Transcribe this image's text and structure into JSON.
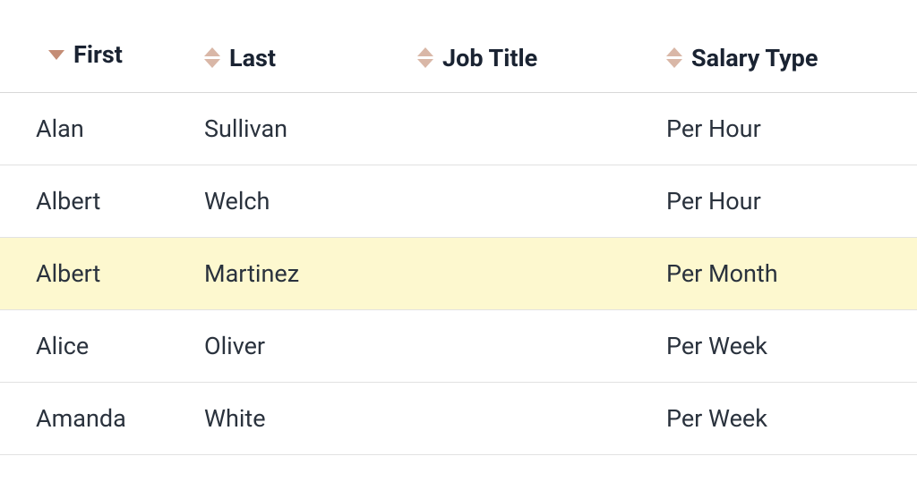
{
  "table": {
    "columns": [
      {
        "key": "first",
        "label": "First",
        "sort": "descending"
      },
      {
        "key": "last",
        "label": "Last",
        "sort": "none"
      },
      {
        "key": "job",
        "label": "Job Title",
        "sort": "none"
      },
      {
        "key": "salary",
        "label": "Salary Type",
        "sort": "none"
      }
    ],
    "highlighted_row_index": 2,
    "rows": [
      {
        "first": "Alan",
        "last": "Sullivan",
        "job": "",
        "salary": "Per Hour"
      },
      {
        "first": "Albert",
        "last": "Welch",
        "job": "",
        "salary": "Per Hour"
      },
      {
        "first": "Albert",
        "last": "Martinez",
        "job": "",
        "salary": "Per Month"
      },
      {
        "first": "Alice",
        "last": "Oliver",
        "job": "",
        "salary": "Per Week"
      },
      {
        "first": "Amanda",
        "last": "White",
        "job": "",
        "salary": "Per Week"
      }
    ]
  },
  "colors": {
    "sort_icon": "#c48d76",
    "sort_icon_light": "#d9b7a7",
    "row_highlight": "#fdf8cf"
  }
}
